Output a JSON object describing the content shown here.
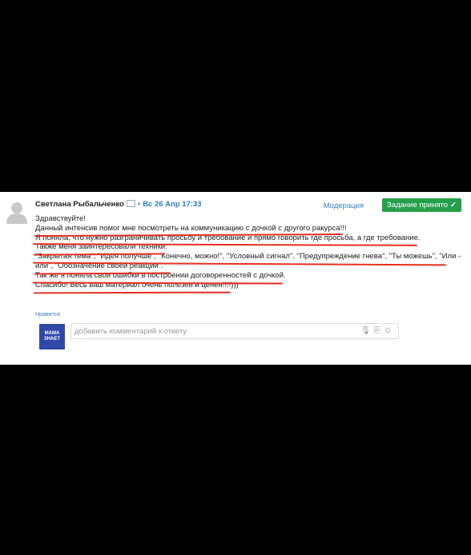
{
  "post": {
    "author": "Светлана Рыбальченко",
    "date": "Вс 26 Апр 17:33",
    "moderation_label": "Модерация",
    "status_label": "Задание принято",
    "status_color": "#24a04a",
    "lines": [
      "Здравствуйте!",
      "Данный интенсив помог мне посмотреть на коммуникацию с дочкой с другого ракурса!!!",
      "Я поняла, что нужно разграничивать просьбу и требование и прямо говорить где просьба, а где требование.",
      "Также меня заинтересовали техники:",
      "\"Закрытая тема\", \"Идея получше\", \"Конечно, можно!\", \"Условный сигнал\", \"Предупреждение гнева\", \"Ты можешь\", \"Или -",
      "или\", \"Обозначение своей реакции\".",
      "Так же я поняла свои ошибки в построении договоренностей с дочкой.",
      "Спасибо! Весь ваш материал очень полезен и ценен!!!!)))"
    ],
    "underline_color": "#e52f22",
    "like_label": "Нравится"
  },
  "reply": {
    "logo_text_line1": "МАМА",
    "logo_text_line2": "ЗНАЕТ",
    "placeholder": "добавить комментарий к ответу",
    "icons": [
      "microphone-icon",
      "paperclip-icon",
      "smiley-icon"
    ]
  }
}
